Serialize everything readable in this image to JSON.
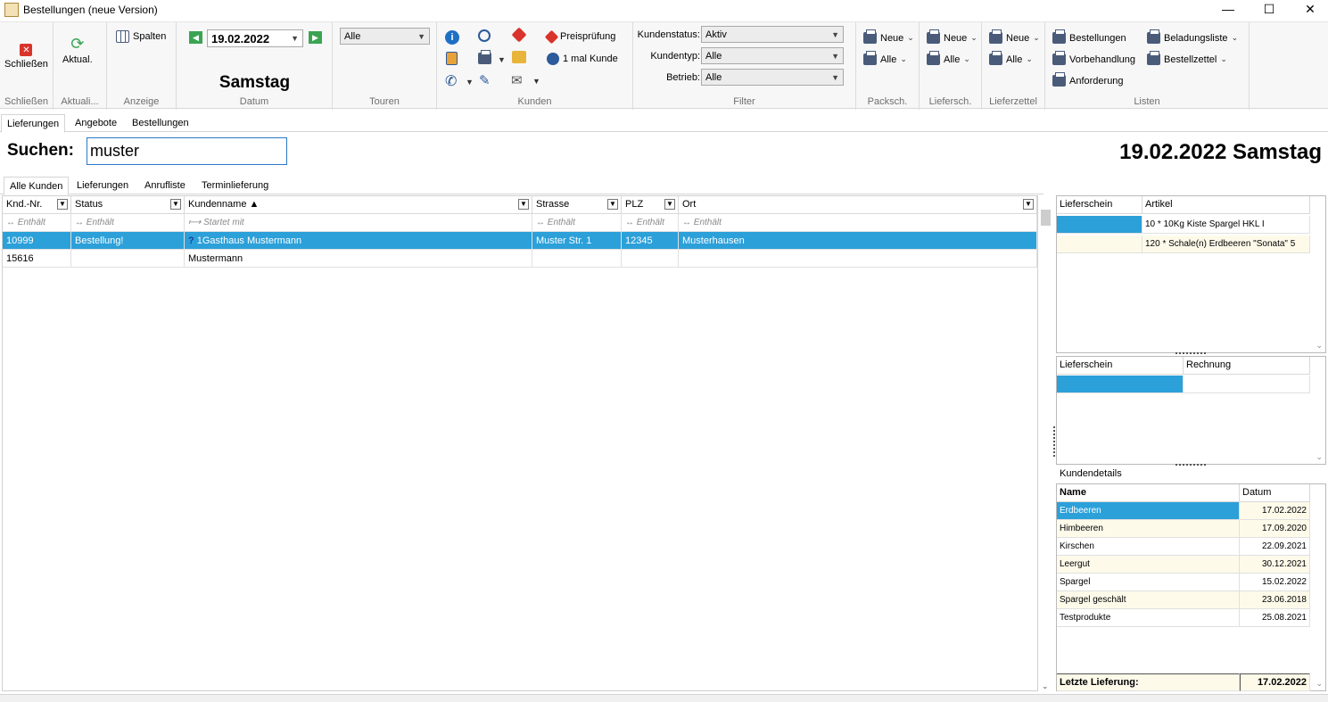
{
  "window": {
    "title": "Bestellungen (neue Version)",
    "minimize": "—",
    "maximize": "☐",
    "close": "✕"
  },
  "ribbon": {
    "close_label": "Schließen",
    "refresh_label": "Aktual.",
    "columns_label": "Spalten",
    "date_value": "19.02.2022",
    "weekday": "Samstag",
    "tours_value": "Alle",
    "price_check": "Preisprüfung",
    "one_time_customer": "1 mal Kunde",
    "filter": {
      "kundenstatus_label": "Kundenstatus:",
      "kundenstatus_value": "Aktiv",
      "kundentyp_label": "Kundentyp:",
      "kundentyp_value": "Alle",
      "betrieb_label": "Betrieb:",
      "betrieb_value": "Alle"
    },
    "neue": "Neue",
    "alle": "Alle",
    "lists": {
      "bestellungen": "Bestellungen",
      "vorbehandlung": "Vorbehandlung",
      "anforderung": "Anforderung",
      "beladungsliste": "Beladungsliste",
      "bestellzettel": "Bestellzettel"
    },
    "group_labels": {
      "schliessen": "Schließen",
      "aktual": "Aktuali...",
      "anzeige": "Anzeige",
      "datum": "Datum",
      "touren": "Touren",
      "kunden": "Kunden",
      "filter": "Filter",
      "packsch": "Packsch.",
      "liefersch": "Liefersch.",
      "lieferzettel": "Lieferzettel",
      "listen": "Listen"
    }
  },
  "main_tabs": [
    "Lieferungen",
    "Angebote",
    "Bestellungen"
  ],
  "search": {
    "label": "Suchen:",
    "value": "muster"
  },
  "big_date": "19.02.2022 Samstag",
  "sub_tabs": [
    "Alle Kunden",
    "Lieferungen",
    "Anrufliste",
    "Terminlieferung"
  ],
  "grid": {
    "columns": [
      "Knd.-Nr.",
      "Status",
      "Kundenname ▲",
      "Strasse",
      "PLZ",
      "Ort"
    ],
    "filters": [
      "Enthält",
      "Enthält",
      "Startet mit",
      "Enthält",
      "Enthält",
      "Enthält"
    ],
    "filter_icon_contains": "↔",
    "filter_icon_starts": "⟼",
    "rows": [
      {
        "nr": "10999",
        "status": "Bestellung!",
        "name": "1Gasthaus Mustermann",
        "strasse": "Muster Str. 1",
        "plz": "12345",
        "ort": "Musterhausen",
        "selected": true
      },
      {
        "nr": "15616",
        "status": "",
        "name": "Mustermann",
        "strasse": "",
        "plz": "",
        "ort": "",
        "selected": false
      }
    ]
  },
  "panel1": {
    "headers": [
      "Lieferschein",
      "Artikel"
    ],
    "rows": [
      [
        "",
        "10 * 10Kg Kiste Spargel HKL I"
      ],
      [
        "",
        "120 * Schale(n) Erdbeeren \"Sonata\" 5"
      ]
    ]
  },
  "panel2": {
    "headers": [
      "Lieferschein",
      "Rechnung"
    ]
  },
  "kundendetails": {
    "title": "Kundendetails",
    "headers": [
      "Name",
      "Datum"
    ],
    "rows": [
      [
        "Erdbeeren",
        "17.02.2022"
      ],
      [
        "Himbeeren",
        "17.09.2020"
      ],
      [
        "Kirschen",
        "22.09.2021"
      ],
      [
        "Leergut",
        "30.12.2021"
      ],
      [
        "Spargel",
        "15.02.2022"
      ],
      [
        "Spargel geschält",
        "23.06.2018"
      ],
      [
        "Testprodukte",
        "25.08.2021"
      ]
    ],
    "footer_label": "Letzte Lieferung:",
    "footer_value": "17.02.2022"
  },
  "colors": {
    "selection": "#2ca0d9",
    "cream": "#fdfaea",
    "accent": "#2a79c8"
  }
}
